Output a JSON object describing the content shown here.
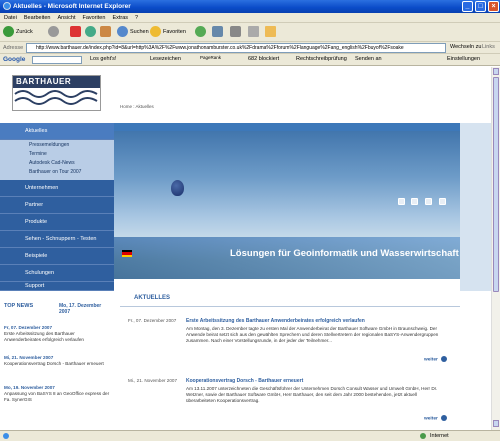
{
  "window": {
    "title": "Aktuelles - Microsoft Internet Explorer"
  },
  "menu": [
    "Datei",
    "Bearbeiten",
    "Ansicht",
    "Favoriten",
    "Extras",
    "?"
  ],
  "toolbar": {
    "back": "Zurück",
    "search": "Suchen",
    "favorites": "Favoriten"
  },
  "address": {
    "label": "Adresse",
    "url": "http://www.barthauer.de/index.php?id=8&url=http%3A%2F%2Fwww.jonathonamburster.co.uk%2Fdrama%2Fforum%2Flanguage%2Fang_english%2Fbuyof%2Fsoake",
    "go": "Wechseln zu",
    "links": "Links"
  },
  "googlebar": {
    "label": "Google",
    "go": "Los geht's!",
    "bookmarks": "Lesezeichen",
    "pagerank": "PageRank",
    "blocked": "682 blockiert",
    "spell": "Rechtschreibprüfung",
    "send": "Senden an",
    "settings": "Einstellungen"
  },
  "site": {
    "logo": "BARTHAUER",
    "breadcrumb": "Home : Aktuelles",
    "nav": [
      "Aktuelles",
      "Unternehmen",
      "Partner",
      "Produkte",
      "Sehen - Schnuppern - Testen",
      "Beispiele",
      "Schulungen",
      "Support"
    ],
    "subnav": [
      "Pressemeldungen",
      "Termine",
      "Autodesk Cad-News",
      "Barthauer on Tour 2007"
    ],
    "hero_text": "Lösungen für Geoinformatik und Wasserwirtschaft",
    "topnews": {
      "label": "TOP NEWS",
      "date": "Mo, 17. Dezember 2007",
      "items": [
        {
          "date": "Fr, 07. Dezember 2007",
          "text": "Erste Arbeitssitzung des Barthauer Anwenderbeirates erfolgreich verlaufen"
        },
        {
          "date": "Mi, 21. November 2007",
          "text": "Kooperationsvertrag Dorsch - Barthauer erneuert"
        },
        {
          "date": "Mo, 19. November 2007",
          "text": "Anpassung von BaSYS 8 an GeoOffice express der Fa. SynerGIS"
        }
      ]
    },
    "aktuelle": {
      "heading": "AKTUELLES",
      "more": "weiter",
      "articles": [
        {
          "date": "Fr., 07. Dezember 2007",
          "title": "Erste Arbeitssitzung des Barthauer Anwenderbeirates erfolgreich verlaufen",
          "body": "Am Montag, den 3. Dezember tagte zu ersten Mal der Anwenderbeirat der Barthauer Software GmbH in Braunschweig. Der Anwende beirat setzt sich aus den gewählten Sprechern und deren Stellvertretern der regionalen BaSYS-Anwendergruppen zusammen. Nach einer Vorstellungsrunde, in der jeder der Teilnehmer..."
        },
        {
          "date": "Mi., 21. November 2007",
          "title": "Kooperationsvertrag Dorsch - Barthauer erneuert",
          "body": "Am 13.11.2007 unterzeichneten die Geschäftsführer der Unternehmen Dorsch Consult Wasser und Umwelt GmbH, Herr Dr. Wetzner, sowie der Barthauer Software GmbH, Herr Barthauer, den seit dem Jahr 2000 bestehenden, jetzt aktuell überarbeiteten Kooperationsvertrag."
        }
      ]
    }
  },
  "status": {
    "zone": "Internet"
  }
}
